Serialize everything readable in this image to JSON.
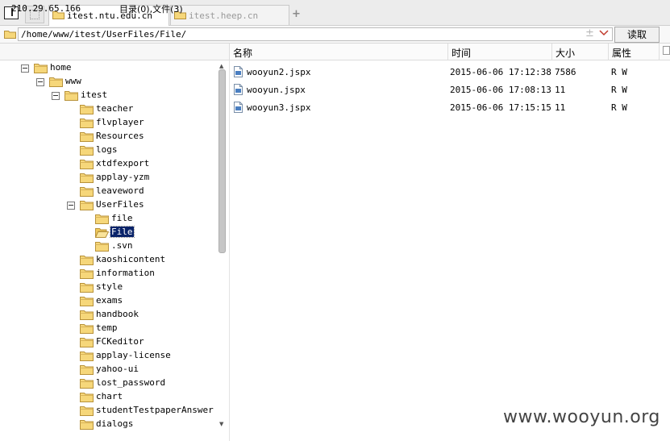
{
  "tabs": [
    {
      "label": "itest.ntu.edu.cn",
      "active": true
    },
    {
      "label": "itest.heep.cn",
      "active": false
    }
  ],
  "add_tab_symbol": "+",
  "path_bar": {
    "value": "/home/www/itest/UserFiles/File/",
    "plus_minus": "±",
    "read_button": "读取"
  },
  "status": {
    "ip": "210.29.65.166",
    "counts": "目录(0),文件(3)"
  },
  "columns": {
    "name": "名称",
    "time": "时间",
    "size": "大小",
    "attr": "属性"
  },
  "tree": [
    {
      "label": "home",
      "depth": 0,
      "toggle": true
    },
    {
      "label": "www",
      "depth": 1,
      "toggle": true
    },
    {
      "label": "itest",
      "depth": 2,
      "toggle": true
    },
    {
      "label": "teacher",
      "depth": 3
    },
    {
      "label": "flvplayer",
      "depth": 3
    },
    {
      "label": "Resources",
      "depth": 3
    },
    {
      "label": "logs",
      "depth": 3
    },
    {
      "label": "xtdfexport",
      "depth": 3
    },
    {
      "label": "applay-yzm",
      "depth": 3
    },
    {
      "label": "leaveword",
      "depth": 3
    },
    {
      "label": "UserFiles",
      "depth": 3,
      "toggle": true
    },
    {
      "label": "file",
      "depth": 4
    },
    {
      "label": "File",
      "depth": 4,
      "selected": true,
      "open": true
    },
    {
      "label": ".svn",
      "depth": 4
    },
    {
      "label": "kaoshicontent",
      "depth": 3
    },
    {
      "label": "information",
      "depth": 3
    },
    {
      "label": "style",
      "depth": 3
    },
    {
      "label": "exams",
      "depth": 3
    },
    {
      "label": "handbook",
      "depth": 3
    },
    {
      "label": "temp",
      "depth": 3
    },
    {
      "label": "FCKeditor",
      "depth": 3
    },
    {
      "label": "applay-license",
      "depth": 3
    },
    {
      "label": "yahoo-ui",
      "depth": 3
    },
    {
      "label": "lost_password",
      "depth": 3
    },
    {
      "label": "chart",
      "depth": 3
    },
    {
      "label": "studentTestpaperAnswer",
      "depth": 3
    },
    {
      "label": "dialogs",
      "depth": 3
    }
  ],
  "files": [
    {
      "name": "wooyun2.jspx",
      "time": "2015-06-06 17:12:38",
      "size": "7586",
      "attr": "R W"
    },
    {
      "name": "wooyun.jspx",
      "time": "2015-06-06 17:08:13",
      "size": "11",
      "attr": "R W"
    },
    {
      "name": "wooyun3.jspx",
      "time": "2015-06-06 17:15:15",
      "size": "11",
      "attr": "R W"
    }
  ],
  "watermark": "www.wooyun.org",
  "colors": {
    "folder_fill": "#f6d77a",
    "folder_stroke": "#b8923a",
    "selection": "#0a246a",
    "file_icon": "#4a7fc1"
  }
}
